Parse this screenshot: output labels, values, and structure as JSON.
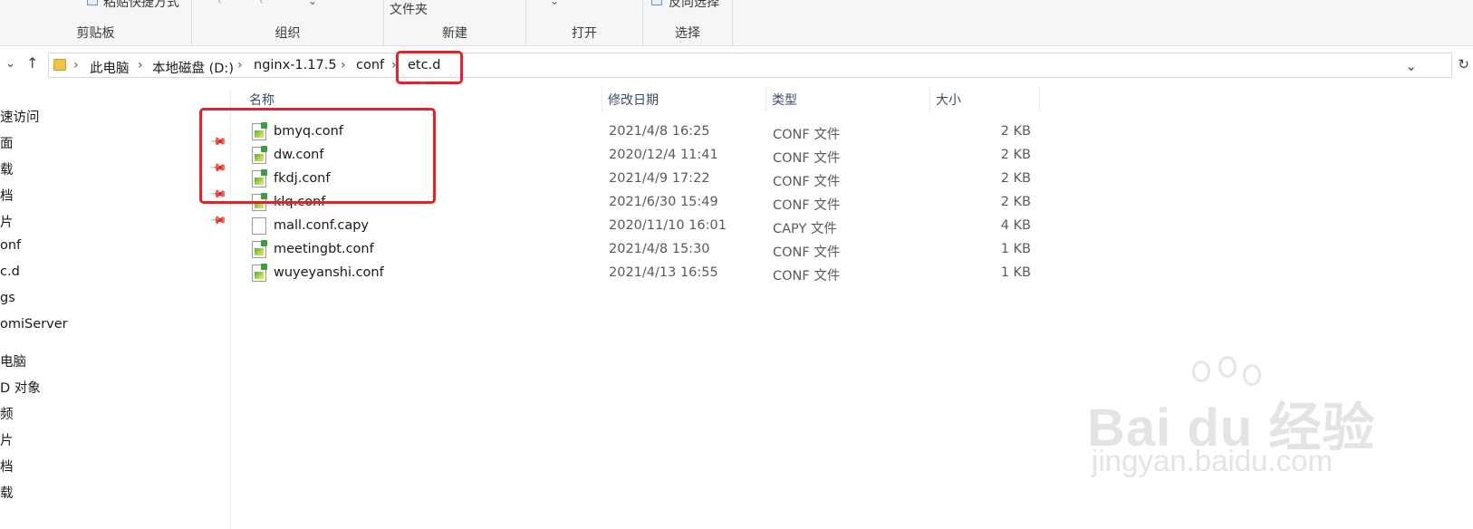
{
  "ribbon": {
    "groups": [
      {
        "label": "剪贴板"
      },
      {
        "label": "组织"
      },
      {
        "label": "新建"
      },
      {
        "label": "打开"
      },
      {
        "label": "选择"
      }
    ],
    "cut_top_texts": {
      "paste_shortcut": "粘贴快捷方式",
      "new_folder": "文件夹",
      "invert_selection": "反向选择"
    }
  },
  "address_bar": {
    "crumbs": [
      "此电脑",
      "本地磁盘 (D:)",
      "nginx-1.17.5",
      "conf",
      "etc.d"
    ]
  },
  "sidebar": {
    "items": [
      {
        "label": "速访问"
      },
      {
        "label": "面"
      },
      {
        "label": "载"
      },
      {
        "label": "档"
      },
      {
        "label": "片"
      },
      {
        "label": "onf"
      },
      {
        "label": "c.d"
      },
      {
        "label": "gs"
      },
      {
        "label": "omiServer"
      },
      {
        "label": "电脑"
      },
      {
        "label": "D 对象"
      },
      {
        "label": "频"
      },
      {
        "label": "片"
      },
      {
        "label": "档"
      },
      {
        "label": "载"
      }
    ]
  },
  "columns": {
    "name": "名称",
    "date": "修改日期",
    "type": "类型",
    "size": "大小"
  },
  "files": [
    {
      "name": "bmyq.conf",
      "date": "2021/4/8 16:25",
      "type": "CONF 文件",
      "size": "2 KB",
      "icon": "conf-file-icon"
    },
    {
      "name": "dw.conf",
      "date": "2020/12/4 11:41",
      "type": "CONF 文件",
      "size": "2 KB",
      "icon": "conf-file-icon"
    },
    {
      "name": "fkdj.conf",
      "date": "2021/4/9 17:22",
      "type": "CONF 文件",
      "size": "2 KB",
      "icon": "conf-file-icon"
    },
    {
      "name": "klq.conf",
      "date": "2021/6/30 15:49",
      "type": "CONF 文件",
      "size": "2 KB",
      "icon": "conf-file-icon"
    },
    {
      "name": "mall.conf.capy",
      "date": "2020/11/10 16:01",
      "type": "CAPY 文件",
      "size": "4 KB",
      "icon": "blank-file-icon"
    },
    {
      "name": "meetingbt.conf",
      "date": "2021/4/8 15:30",
      "type": "CONF 文件",
      "size": "1 KB",
      "icon": "conf-file-icon"
    },
    {
      "name": "wuyeyanshi.conf",
      "date": "2021/4/13 16:55",
      "type": "CONF 文件",
      "size": "1 KB",
      "icon": "conf-file-icon"
    }
  ],
  "watermark": {
    "brand": "Bai du 经验",
    "url": "jingyan.baidu.com"
  },
  "colors": {
    "highlight": "#e2232b",
    "ribbon_bg": "#f5f6f7"
  }
}
